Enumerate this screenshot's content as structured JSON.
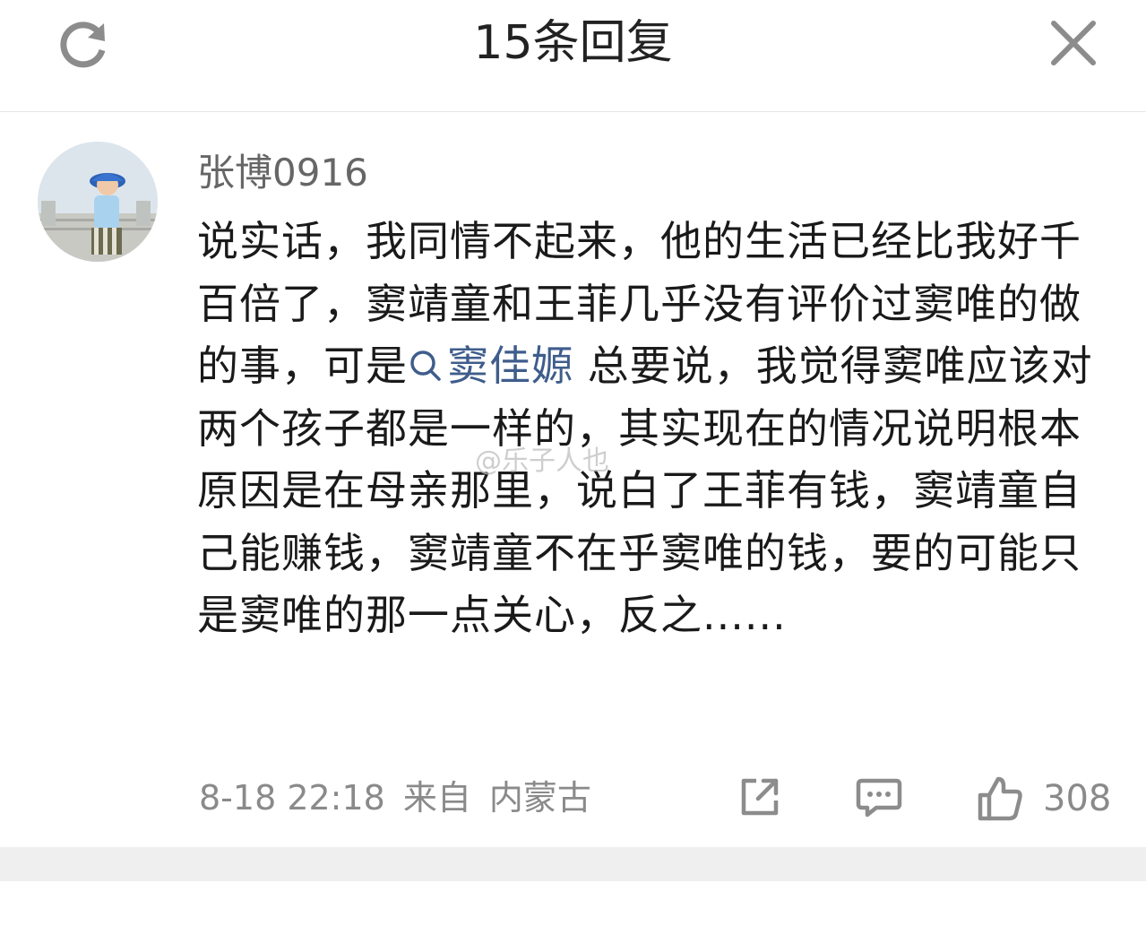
{
  "header": {
    "title": "15条回复",
    "refresh_icon": "refresh-icon",
    "close_icon": "close-icon"
  },
  "comment": {
    "username": "张博0916",
    "avatar": "user-avatar",
    "content_before": "说实话，我同情不起来，他的生活已经比我好千百倍了，窦靖童和王菲几乎没有评价过窦唯的做的事，可是",
    "mention": "窦佳嫄",
    "content_after": " 总要说，我觉得窦唯应该对两个孩子都是一样的，其实现在的情况说明根本原因是在母亲那里，说白了王菲有钱，窦靖童自己能赚钱，窦靖童不在乎窦唯的钱，要的可能只是窦唯的那一点关心，反之......",
    "date": "8-18 22:18",
    "source_label": "来自",
    "location": "内蒙古",
    "like_count": "308"
  },
  "watermark": "@乐子人也",
  "colors": {
    "mention": "#3f5d8c",
    "meta_gray": "#8a8a8a",
    "text": "#1a1a1a"
  }
}
